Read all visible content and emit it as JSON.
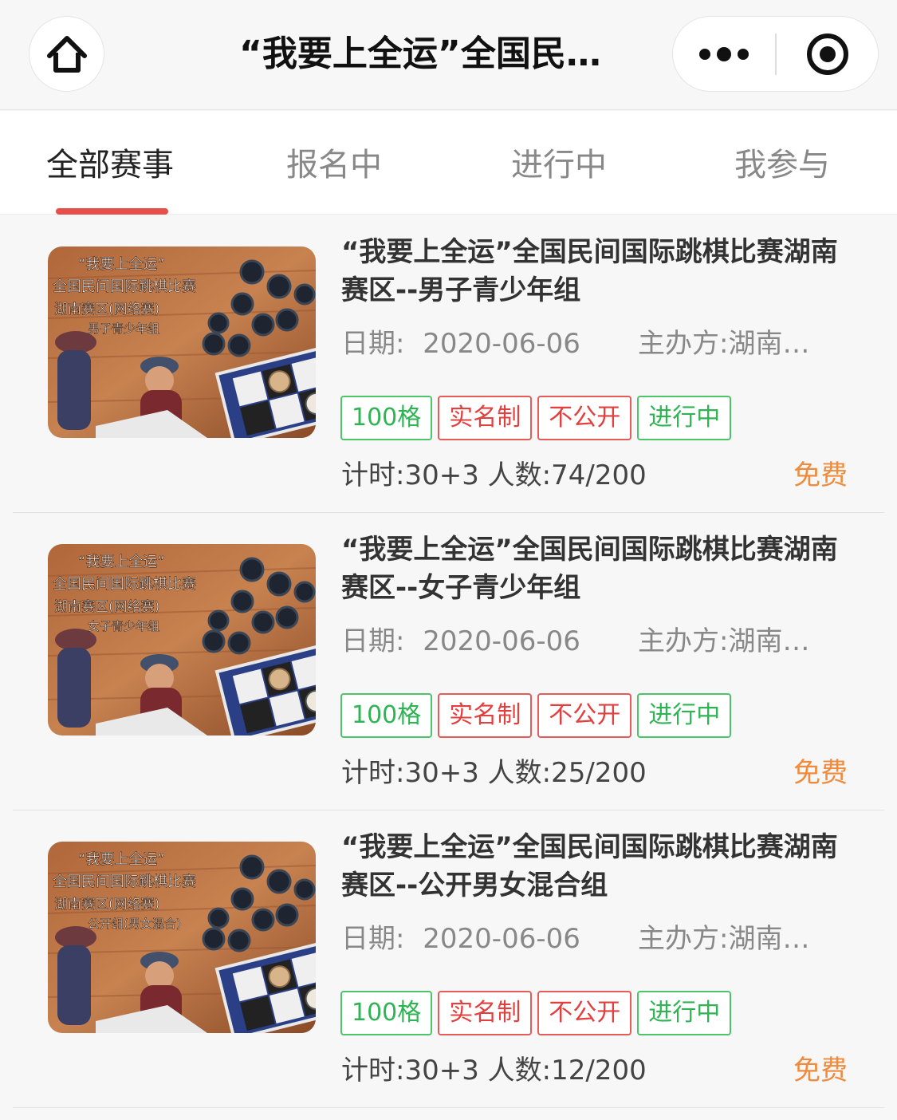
{
  "nav": {
    "title": "“我要上全运”全国民…",
    "home_icon": "home-icon",
    "more_icon": "more-dots-icon",
    "close_icon": "target-circle-icon"
  },
  "tabs": [
    {
      "label": "全部赛事",
      "active": true
    },
    {
      "label": "报名中",
      "active": false
    },
    {
      "label": "进行中",
      "active": false
    },
    {
      "label": "我参与",
      "active": false
    }
  ],
  "events": [
    {
      "title": "“我要上全运”全国民间国际跳棋比赛湖南赛区--男子青少年组",
      "date_label": "日期:",
      "date": "2020-06-06",
      "organizer_label": "主办方:",
      "organizer": "湖南…",
      "tags": [
        "100格",
        "实名制",
        "不公开",
        "进行中"
      ],
      "info": "计时:30+3 人数:74/200",
      "price": "免费",
      "poster": {
        "line1": "“我要上全运”",
        "line2": "全国民间国际跳棋比赛",
        "line3": "湖南赛区(网络赛)",
        "line4": "男子青少年组"
      }
    },
    {
      "title": "“我要上全运”全国民间国际跳棋比赛湖南赛区--女子青少年组",
      "date_label": "日期:",
      "date": "2020-06-06",
      "organizer_label": "主办方:",
      "organizer": "湖南…",
      "tags": [
        "100格",
        "实名制",
        "不公开",
        "进行中"
      ],
      "info": "计时:30+3 人数:25/200",
      "price": "免费",
      "poster": {
        "line1": "“我要上全运”",
        "line2": "全国民间国际跳棋比赛",
        "line3": "湖南赛区(网络赛)",
        "line4": "女子青少年组"
      }
    },
    {
      "title": "“我要上全运”全国民间国际跳棋比赛湖南赛区--公开男女混合组",
      "date_label": "日期:",
      "date": "2020-06-06",
      "organizer_label": "主办方:",
      "organizer": "湖南…",
      "tags": [
        "100格",
        "实名制",
        "不公开",
        "进行中"
      ],
      "info": "计时:30+3 人数:12/200",
      "price": "免费",
      "poster": {
        "line1": "“我要上全运”",
        "line2": "全国民间国际跳棋比赛",
        "line3": "湖南赛区(网络赛)",
        "line4": "公开组(男女混合)"
      }
    }
  ],
  "colors": {
    "accent": "#e84e4a",
    "tag_green": "#2fb454",
    "tag_red": "#e2403e",
    "price": "#f08a3c"
  }
}
